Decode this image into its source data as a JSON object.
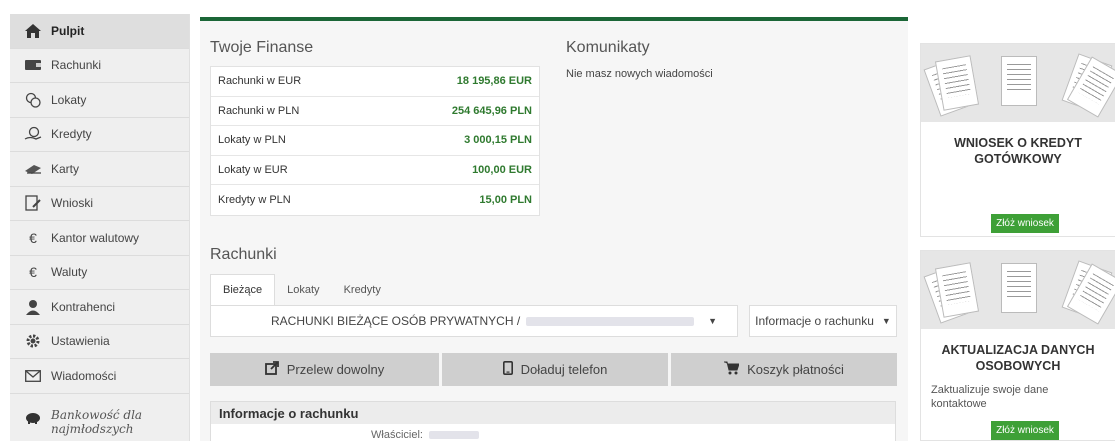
{
  "sidebar": {
    "items": [
      {
        "label": "Pulpit",
        "icon": "home-icon",
        "active": true
      },
      {
        "label": "Rachunki",
        "icon": "wallet-icon"
      },
      {
        "label": "Lokaty",
        "icon": "coins-icon"
      },
      {
        "label": "Kredyty",
        "icon": "hand-coins-icon"
      },
      {
        "label": "Karty",
        "icon": "card-icon"
      },
      {
        "label": "Wnioski",
        "icon": "application-icon"
      },
      {
        "label": "Kantor walutowy",
        "icon": "euro-icon"
      },
      {
        "label": "Waluty",
        "icon": "euro-icon"
      },
      {
        "label": "Kontrahenci",
        "icon": "contacts-icon"
      },
      {
        "label": "Ustawienia",
        "icon": "gear-icon"
      },
      {
        "label": "Wiadomości",
        "icon": "envelope-icon"
      }
    ],
    "special": {
      "label": "Bankowość dla najmłodszych",
      "icon": "piggy-bank-icon"
    }
  },
  "finances": {
    "title": "Twoje Finanse",
    "rows": [
      {
        "label": "Rachunki w EUR",
        "value": "18 195,86 EUR"
      },
      {
        "label": "Rachunki w PLN",
        "value": "254 645,96 PLN"
      },
      {
        "label": "Lokaty w PLN",
        "value": "3 000,15 PLN"
      },
      {
        "label": "Lokaty w EUR",
        "value": "100,00 EUR"
      },
      {
        "label": "Kredyty w PLN",
        "value": "15,00 PLN"
      }
    ]
  },
  "messages": {
    "title": "Komunikaty",
    "text": "Nie masz nowych wiadomości"
  },
  "accounts": {
    "title": "Rachunki",
    "tabs": [
      "Bieżące",
      "Lokaty",
      "Kredyty"
    ],
    "selected_account": "RACHUNKI BIEŻĄCE OSÓB PRYWATNYCH /",
    "info_dropdown": "Informacje o rachunku",
    "actions": [
      {
        "label": "Przelew dowolny",
        "icon": "external-link-icon"
      },
      {
        "label": "Doładuj telefon",
        "icon": "phone-icon"
      },
      {
        "label": "Koszyk płatności",
        "icon": "cart-icon"
      }
    ],
    "info_box": {
      "title": "Informacje o rachunku",
      "owner_label": "Właściciel:"
    }
  },
  "ads": [
    {
      "title": "WNIOSEK O KREDYT GOTÓWKOWY",
      "desc": "",
      "button": "Złóż wniosek"
    },
    {
      "title": "AKTUALIZACJA DANYCH OSOBOWYCH",
      "desc": "Zaktualizuje swoje dane kontaktowe",
      "button": "Złóż wniosek"
    }
  ],
  "colors": {
    "accent": "#1b6637",
    "value_green": "#2f7a2f",
    "button_green": "#3ea037"
  }
}
